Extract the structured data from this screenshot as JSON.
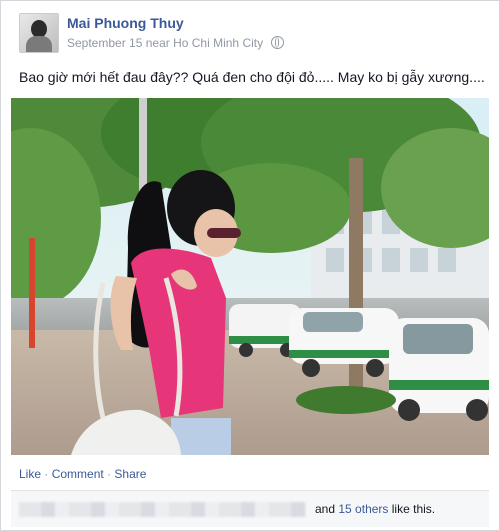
{
  "post": {
    "author": "Mai Phuong Thuy",
    "date": "September 15",
    "location": "near Ho Chi Minh City",
    "privacy_icon": "globe-icon",
    "text": "Bao giờ mới hết đau đây?? Quá đen cho đội đỏ..... May ko bị gẫy xương...."
  },
  "actions": {
    "like": "Like",
    "comment": "Comment",
    "share": "Share",
    "separator": "·"
  },
  "likes": {
    "and": "and",
    "others": "15 others",
    "suffix": "like this."
  },
  "colors": {
    "link": "#3b5998",
    "meta": "#9197a3",
    "likes_bg": "#f6f7f8"
  }
}
